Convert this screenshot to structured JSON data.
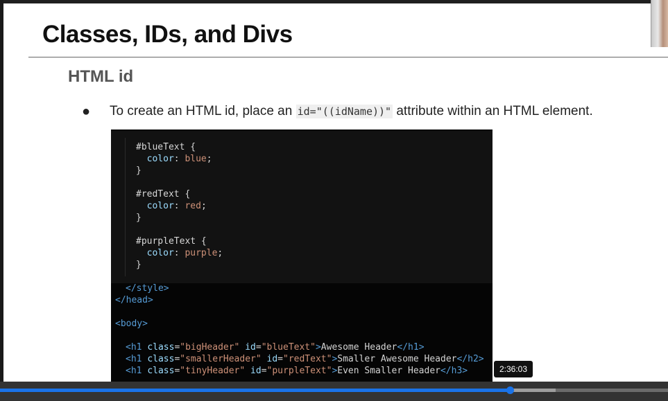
{
  "slide": {
    "title": "Classes, IDs, and Divs",
    "section_heading": "HTML id",
    "bullet": {
      "dot": "●",
      "text_before": "To create an HTML id, place an ",
      "code": "id=\"((idName))\"",
      "text_after": " attribute within an HTML element."
    }
  },
  "code": {
    "lines": [
      "#blueText {",
      "  color: blue;",
      "}",
      "#redText {",
      "  color: red;",
      "}",
      "#purpleText {",
      "  color: purple;",
      "}",
      "</style>",
      "</head>",
      "<body>",
      "<h1 class=\"bigHeader\" id=\"blueText\">Awesome Header</h1>",
      "<h1 class=\"smallerHeader\" id=\"redText\">Smaller Awesome Header</h2>",
      "<h1 class=\"tinyHeader\" id=\"purpleText\">Even Smaller Header</h3>"
    ]
  },
  "player": {
    "timestamp": "2:36:03",
    "progress_fraction": 0.763,
    "buffered_fraction": 0.832
  },
  "colors": {
    "accent": "#1a73e8",
    "code_bg": "#0d0d0d"
  }
}
